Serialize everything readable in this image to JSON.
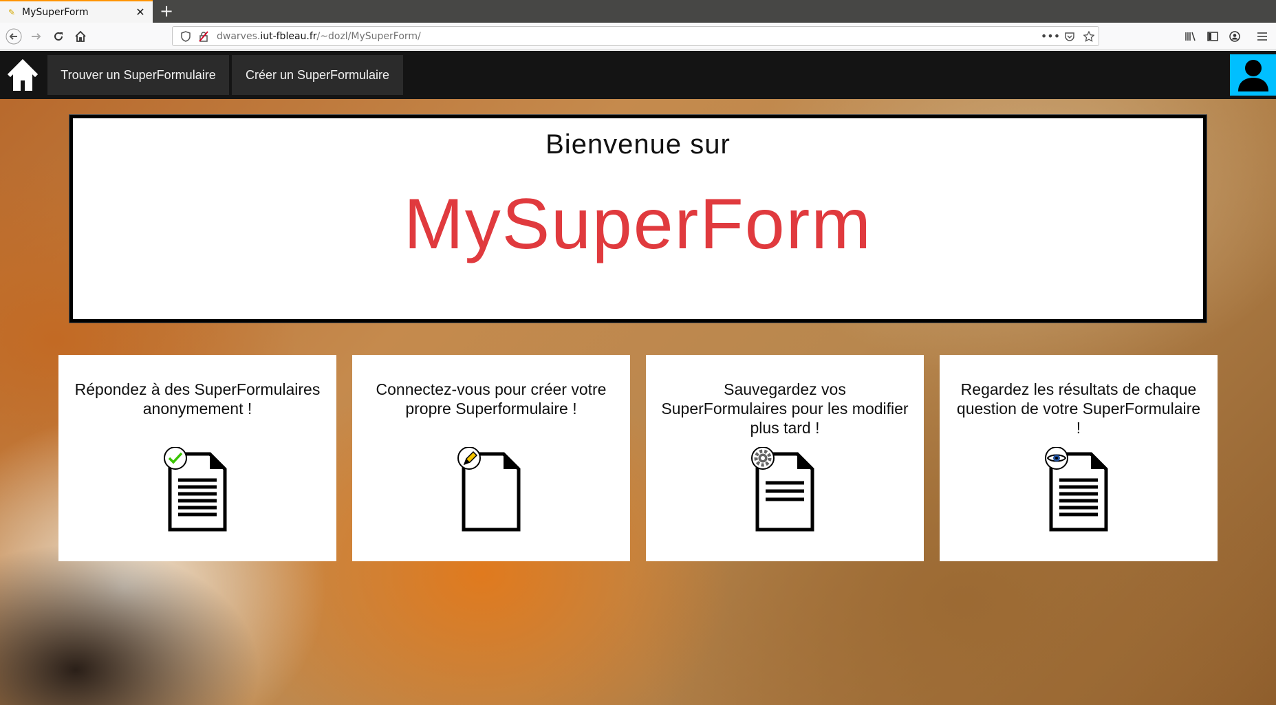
{
  "browser": {
    "tab_title": "MySuperForm",
    "url_prefix": "dwarves.",
    "url_domain": "iut-fbleau.fr",
    "url_path": "/~dozl/MySuperForm/",
    "page_actions_label": "•••"
  },
  "site": {
    "nav": {
      "find_label": "Trouver un SuperFormulaire",
      "create_label": "Créer un SuperFormulaire"
    },
    "welcome": {
      "subtitle": "Bienvenue sur",
      "brand": "MySuperForm",
      "brand_color": "#e03a3e"
    },
    "user_button_color": "#00bfff",
    "cards": [
      {
        "text": "Répondez à des SuperFormulaires anonymement !",
        "icon": "document-check-icon"
      },
      {
        "text": "Connectez-vous pour créer votre propre Superformulaire !",
        "icon": "document-pencil-icon"
      },
      {
        "text": "Sauvegardez vos SuperFormulaires pour les modifier plus tard !",
        "icon": "document-gear-icon"
      },
      {
        "text": "Regardez les résultats de chaque question de votre SuperFormulaire !",
        "icon": "document-eye-icon"
      }
    ]
  }
}
